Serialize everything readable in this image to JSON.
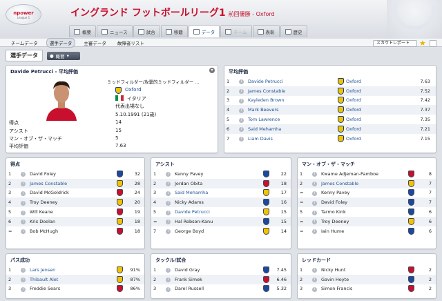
{
  "app": {
    "logo_text": "npower",
    "logo_sub": "League 1",
    "title": "イングランド フットボールリーグ1",
    "subtitle": "前回優勝 - Oxford"
  },
  "tabs": [
    "概要",
    "ニュース",
    "試合",
    "移籍",
    "データ",
    "チーム",
    "表彰",
    "歴史"
  ],
  "subnav": [
    "チームデータ",
    "選手データ",
    "主審データ",
    "故障者リスト"
  ],
  "scout_label": "スカウトレポート",
  "section_label": "選手データ",
  "overview_label": "概要",
  "player": {
    "title": "Davide Petrucci - 平均評価",
    "position": "ミッドフィルダー/攻撃的ミッドフィルダー ...",
    "club": "Oxford",
    "nation": "イタリア",
    "caps": "代表出場なし",
    "dob": "5.10.1991 (21歳)",
    "stats": [
      {
        "label": "得点",
        "value": "14"
      },
      {
        "label": "アシスト",
        "value": "15"
      },
      {
        "label": "マン・オブ・ザ・マッチ",
        "value": "5"
      },
      {
        "label": "平均評価",
        "value": "7.63"
      }
    ]
  },
  "avg_rating": {
    "title": "平均評価",
    "rows": [
      {
        "rank": "1",
        "name": "Davide Petrucci",
        "club": "Oxford",
        "value": "7.63"
      },
      {
        "rank": "2",
        "name": "James Constable",
        "club": "Oxford",
        "value": "7.52"
      },
      {
        "rank": "3",
        "name": "Kayleden Brown",
        "club": "Oxford",
        "value": "7.42"
      },
      {
        "rank": "4",
        "name": "Mark Beevers",
        "club": "Oxford",
        "value": "7.37"
      },
      {
        "rank": "5",
        "name": "Tom Lawrence",
        "club": "Oxford",
        "value": "7.35"
      },
      {
        "rank": "6",
        "name": "Said Mehamha",
        "club": "Oxford",
        "value": "7.21"
      },
      {
        "rank": "7",
        "name": "Liam Davis",
        "club": "Oxford",
        "value": "7.15"
      }
    ]
  },
  "goals": {
    "title": "得点",
    "rows": [
      {
        "rank": "1",
        "name": "David Foley",
        "value": "32",
        "link": false,
        "color": "#1a4aa0"
      },
      {
        "rank": "2",
        "name": "James Constable",
        "value": "28",
        "link": true,
        "color": "#f1c400"
      },
      {
        "rank": "3",
        "name": "David McGoldrick",
        "value": "24",
        "link": false,
        "color": "#c8102e"
      },
      {
        "rank": "4",
        "name": "Troy Deeney",
        "value": "20",
        "link": false,
        "color": "#f1c400"
      },
      {
        "rank": "5",
        "name": "Will Keane",
        "value": "19",
        "link": false,
        "color": "#c8102e"
      },
      {
        "rank": "6",
        "name": "Kris Doolan",
        "value": "18",
        "link": false,
        "color": "#f1c400"
      },
      {
        "rank": "=",
        "name": "Bob McHugh",
        "value": "18",
        "link": false,
        "color": "#c8102e"
      }
    ]
  },
  "assists": {
    "title": "アシスト",
    "rows": [
      {
        "rank": "1",
        "name": "Kenny Pavey",
        "value": "22",
        "link": false,
        "color": "#1a4aa0"
      },
      {
        "rank": "2",
        "name": "Jordan Obita",
        "value": "18",
        "link": false,
        "color": "#c8102e"
      },
      {
        "rank": "3",
        "name": "Said Mehamha",
        "value": "17",
        "link": true,
        "color": "#f1c400"
      },
      {
        "rank": "4",
        "name": "Nicky Adams",
        "value": "16",
        "link": false,
        "color": "#1a4aa0"
      },
      {
        "rank": "5",
        "name": "Davide Petrucci",
        "value": "15",
        "link": true,
        "color": "#f1c400"
      },
      {
        "rank": "=",
        "name": "Hal Robson-Kanu",
        "value": "15",
        "link": false,
        "color": "#1a4aa0"
      },
      {
        "rank": "7",
        "name": "George Boyd",
        "value": "14",
        "link": false,
        "color": "#f1c400"
      }
    ]
  },
  "motm": {
    "title": "マン・オブ・ザ・マッチ",
    "rows": [
      {
        "rank": "1",
        "name": "Kwame Adjeman-Pamboe",
        "value": "8",
        "link": false,
        "color": "#c8102e"
      },
      {
        "rank": "2",
        "name": "James Constable",
        "value": "7",
        "link": true,
        "color": "#f1c400"
      },
      {
        "rank": "=",
        "name": "Kenny Pavey",
        "value": "7",
        "link": false,
        "color": "#1a4aa0"
      },
      {
        "rank": "=",
        "name": "David Foley",
        "value": "7",
        "link": false,
        "color": "#1a4aa0"
      },
      {
        "rank": "5",
        "name": "Tarmo Kink",
        "value": "6",
        "link": false,
        "color": "#1a4aa0"
      },
      {
        "rank": "=",
        "name": "Troy Deeney",
        "value": "6",
        "link": false,
        "color": "#f1c400"
      },
      {
        "rank": "=",
        "name": "Iain Hume",
        "value": "6",
        "link": false,
        "color": "#1a4aa0"
      }
    ]
  },
  "pass": {
    "title": "パス成功",
    "rows": [
      {
        "rank": "1",
        "name": "Lars Jensen",
        "value": "91%",
        "link": true,
        "color": "#f1c400"
      },
      {
        "rank": "2",
        "name": "Thibault Alet",
        "value": "87%",
        "link": true,
        "color": "#f1c400"
      },
      {
        "rank": "3",
        "name": "Freddie Sears",
        "value": "86%",
        "link": false,
        "color": "#c8102e"
      }
    ]
  },
  "tackle": {
    "title": "タックル/試合",
    "rows": [
      {
        "rank": "1",
        "name": "David Gray",
        "value": "7.45",
        "link": false,
        "color": "#1a4aa0"
      },
      {
        "rank": "2",
        "name": "Frank Simek",
        "value": "6.46",
        "link": false,
        "color": "#c8102e"
      },
      {
        "rank": "3",
        "name": "Darel Russell",
        "value": "5.32",
        "link": false,
        "color": "#1a4aa0"
      }
    ]
  },
  "red": {
    "title": "レッドカード",
    "rows": [
      {
        "rank": "1",
        "name": "Nicky Hunt",
        "value": "2",
        "link": false,
        "color": "#c8102e"
      },
      {
        "rank": "2",
        "name": "Gavin Hoyte",
        "value": "2",
        "link": false,
        "color": "#1a4aa0"
      },
      {
        "rank": "3",
        "name": "Simon Francis",
        "value": "2",
        "link": false,
        "color": "#c8102e"
      }
    ]
  }
}
